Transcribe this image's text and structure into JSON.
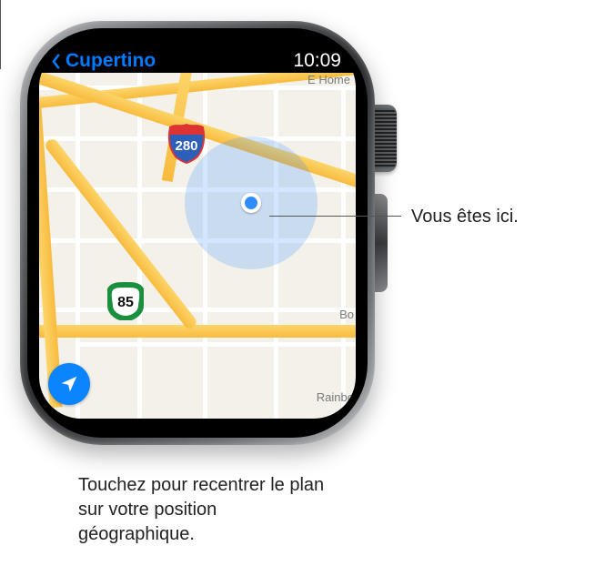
{
  "statusbar": {
    "back_title": "Cupertino",
    "time": "10:09"
  },
  "map": {
    "labels": {
      "home": "E Home",
      "bo": "Bo",
      "rainbow": "Rainbo"
    },
    "shields": {
      "i280": "280",
      "ca85": "85"
    }
  },
  "callouts": {
    "here": "Vous êtes ici.",
    "locate": "Touchez pour recentrer le plan sur votre position géographique."
  }
}
